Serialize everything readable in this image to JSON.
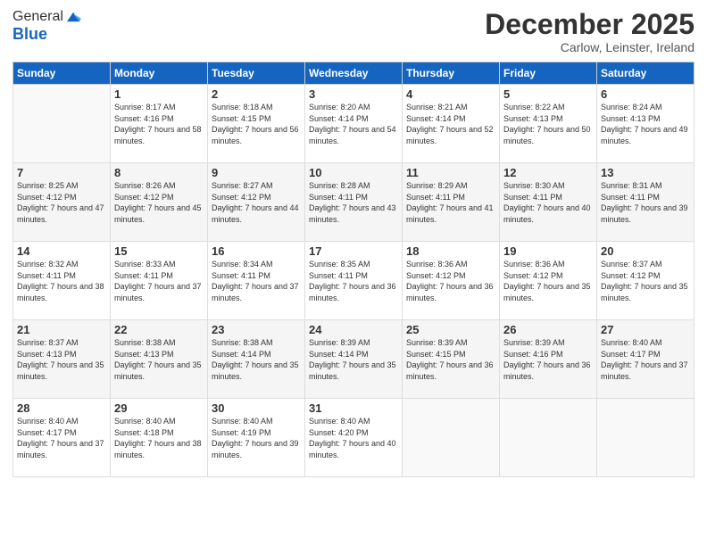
{
  "header": {
    "logo_general": "General",
    "logo_blue": "Blue",
    "month_title": "December 2025",
    "subtitle": "Carlow, Leinster, Ireland"
  },
  "weekdays": [
    "Sunday",
    "Monday",
    "Tuesday",
    "Wednesday",
    "Thursday",
    "Friday",
    "Saturday"
  ],
  "weeks": [
    [
      {
        "day": "",
        "sunrise": "",
        "sunset": "",
        "daylight": ""
      },
      {
        "day": "1",
        "sunrise": "Sunrise: 8:17 AM",
        "sunset": "Sunset: 4:16 PM",
        "daylight": "Daylight: 7 hours and 58 minutes."
      },
      {
        "day": "2",
        "sunrise": "Sunrise: 8:18 AM",
        "sunset": "Sunset: 4:15 PM",
        "daylight": "Daylight: 7 hours and 56 minutes."
      },
      {
        "day": "3",
        "sunrise": "Sunrise: 8:20 AM",
        "sunset": "Sunset: 4:14 PM",
        "daylight": "Daylight: 7 hours and 54 minutes."
      },
      {
        "day": "4",
        "sunrise": "Sunrise: 8:21 AM",
        "sunset": "Sunset: 4:14 PM",
        "daylight": "Daylight: 7 hours and 52 minutes."
      },
      {
        "day": "5",
        "sunrise": "Sunrise: 8:22 AM",
        "sunset": "Sunset: 4:13 PM",
        "daylight": "Daylight: 7 hours and 50 minutes."
      },
      {
        "day": "6",
        "sunrise": "Sunrise: 8:24 AM",
        "sunset": "Sunset: 4:13 PM",
        "daylight": "Daylight: 7 hours and 49 minutes."
      }
    ],
    [
      {
        "day": "7",
        "sunrise": "Sunrise: 8:25 AM",
        "sunset": "Sunset: 4:12 PM",
        "daylight": "Daylight: 7 hours and 47 minutes."
      },
      {
        "day": "8",
        "sunrise": "Sunrise: 8:26 AM",
        "sunset": "Sunset: 4:12 PM",
        "daylight": "Daylight: 7 hours and 45 minutes."
      },
      {
        "day": "9",
        "sunrise": "Sunrise: 8:27 AM",
        "sunset": "Sunset: 4:12 PM",
        "daylight": "Daylight: 7 hours and 44 minutes."
      },
      {
        "day": "10",
        "sunrise": "Sunrise: 8:28 AM",
        "sunset": "Sunset: 4:11 PM",
        "daylight": "Daylight: 7 hours and 43 minutes."
      },
      {
        "day": "11",
        "sunrise": "Sunrise: 8:29 AM",
        "sunset": "Sunset: 4:11 PM",
        "daylight": "Daylight: 7 hours and 41 minutes."
      },
      {
        "day": "12",
        "sunrise": "Sunrise: 8:30 AM",
        "sunset": "Sunset: 4:11 PM",
        "daylight": "Daylight: 7 hours and 40 minutes."
      },
      {
        "day": "13",
        "sunrise": "Sunrise: 8:31 AM",
        "sunset": "Sunset: 4:11 PM",
        "daylight": "Daylight: 7 hours and 39 minutes."
      }
    ],
    [
      {
        "day": "14",
        "sunrise": "Sunrise: 8:32 AM",
        "sunset": "Sunset: 4:11 PM",
        "daylight": "Daylight: 7 hours and 38 minutes."
      },
      {
        "day": "15",
        "sunrise": "Sunrise: 8:33 AM",
        "sunset": "Sunset: 4:11 PM",
        "daylight": "Daylight: 7 hours and 37 minutes."
      },
      {
        "day": "16",
        "sunrise": "Sunrise: 8:34 AM",
        "sunset": "Sunset: 4:11 PM",
        "daylight": "Daylight: 7 hours and 37 minutes."
      },
      {
        "day": "17",
        "sunrise": "Sunrise: 8:35 AM",
        "sunset": "Sunset: 4:11 PM",
        "daylight": "Daylight: 7 hours and 36 minutes."
      },
      {
        "day": "18",
        "sunrise": "Sunrise: 8:36 AM",
        "sunset": "Sunset: 4:12 PM",
        "daylight": "Daylight: 7 hours and 36 minutes."
      },
      {
        "day": "19",
        "sunrise": "Sunrise: 8:36 AM",
        "sunset": "Sunset: 4:12 PM",
        "daylight": "Daylight: 7 hours and 35 minutes."
      },
      {
        "day": "20",
        "sunrise": "Sunrise: 8:37 AM",
        "sunset": "Sunset: 4:12 PM",
        "daylight": "Daylight: 7 hours and 35 minutes."
      }
    ],
    [
      {
        "day": "21",
        "sunrise": "Sunrise: 8:37 AM",
        "sunset": "Sunset: 4:13 PM",
        "daylight": "Daylight: 7 hours and 35 minutes."
      },
      {
        "day": "22",
        "sunrise": "Sunrise: 8:38 AM",
        "sunset": "Sunset: 4:13 PM",
        "daylight": "Daylight: 7 hours and 35 minutes."
      },
      {
        "day": "23",
        "sunrise": "Sunrise: 8:38 AM",
        "sunset": "Sunset: 4:14 PM",
        "daylight": "Daylight: 7 hours and 35 minutes."
      },
      {
        "day": "24",
        "sunrise": "Sunrise: 8:39 AM",
        "sunset": "Sunset: 4:14 PM",
        "daylight": "Daylight: 7 hours and 35 minutes."
      },
      {
        "day": "25",
        "sunrise": "Sunrise: 8:39 AM",
        "sunset": "Sunset: 4:15 PM",
        "daylight": "Daylight: 7 hours and 36 minutes."
      },
      {
        "day": "26",
        "sunrise": "Sunrise: 8:39 AM",
        "sunset": "Sunset: 4:16 PM",
        "daylight": "Daylight: 7 hours and 36 minutes."
      },
      {
        "day": "27",
        "sunrise": "Sunrise: 8:40 AM",
        "sunset": "Sunset: 4:17 PM",
        "daylight": "Daylight: 7 hours and 37 minutes."
      }
    ],
    [
      {
        "day": "28",
        "sunrise": "Sunrise: 8:40 AM",
        "sunset": "Sunset: 4:17 PM",
        "daylight": "Daylight: 7 hours and 37 minutes."
      },
      {
        "day": "29",
        "sunrise": "Sunrise: 8:40 AM",
        "sunset": "Sunset: 4:18 PM",
        "daylight": "Daylight: 7 hours and 38 minutes."
      },
      {
        "day": "30",
        "sunrise": "Sunrise: 8:40 AM",
        "sunset": "Sunset: 4:19 PM",
        "daylight": "Daylight: 7 hours and 39 minutes."
      },
      {
        "day": "31",
        "sunrise": "Sunrise: 8:40 AM",
        "sunset": "Sunset: 4:20 PM",
        "daylight": "Daylight: 7 hours and 40 minutes."
      },
      {
        "day": "",
        "sunrise": "",
        "sunset": "",
        "daylight": ""
      },
      {
        "day": "",
        "sunrise": "",
        "sunset": "",
        "daylight": ""
      },
      {
        "day": "",
        "sunrise": "",
        "sunset": "",
        "daylight": ""
      }
    ]
  ]
}
